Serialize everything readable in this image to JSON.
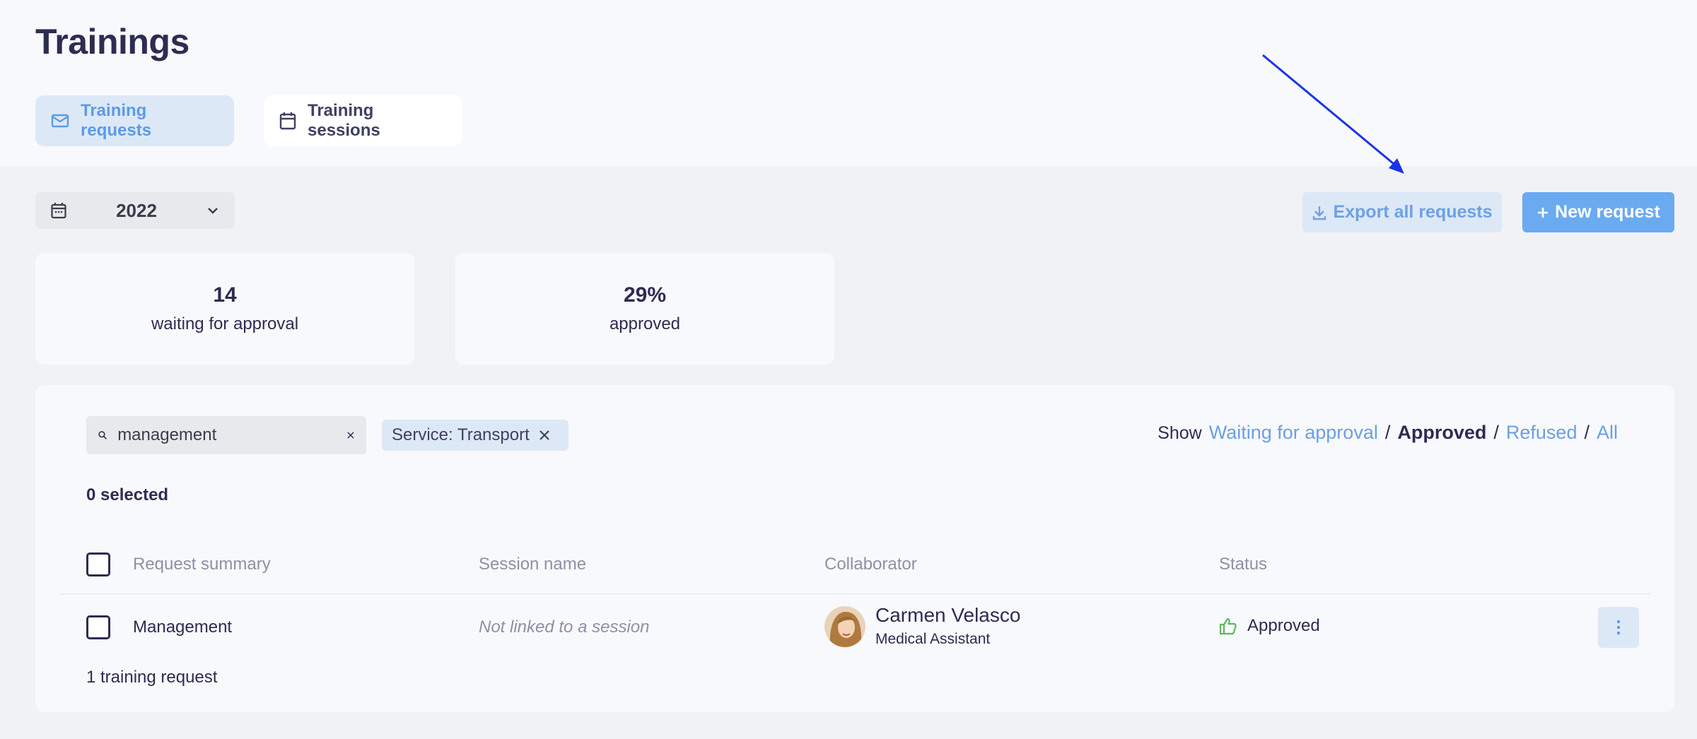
{
  "page": {
    "title": "Trainings"
  },
  "tabs": [
    {
      "label": "Training requests",
      "icon": "mail-icon",
      "active": true
    },
    {
      "label": "Training sessions",
      "icon": "calendar-icon",
      "active": false
    }
  ],
  "toolbar": {
    "year": "2022",
    "export_label": "Export all requests",
    "new_label": "New request"
  },
  "stats": [
    {
      "value": "14",
      "label": "waiting for approval"
    },
    {
      "value": "29%",
      "label": "approved"
    }
  ],
  "filters": {
    "search_value": "management",
    "chip_label": "Service: Transport",
    "show_label": "Show",
    "options": [
      "Waiting for approval",
      "Approved",
      "Refused",
      "All"
    ],
    "active_option": "Approved",
    "separator": "/"
  },
  "selection": {
    "label": "0 selected"
  },
  "table": {
    "headers": [
      "Request summary",
      "Session name",
      "Collaborator",
      "Status"
    ],
    "rows": [
      {
        "summary": "Management",
        "session": "Not linked to a session",
        "collaborator_name": "Carmen Velasco",
        "collaborator_role": "Medical Assistant",
        "status": "Approved"
      }
    ],
    "footer": "1 training request"
  },
  "colors": {
    "accent": "#6aaaf1",
    "accent_light": "#dde8f7",
    "text": "#2b2d52",
    "approved_green": "#5cb85c",
    "annotation_arrow": "#1a33e6"
  }
}
